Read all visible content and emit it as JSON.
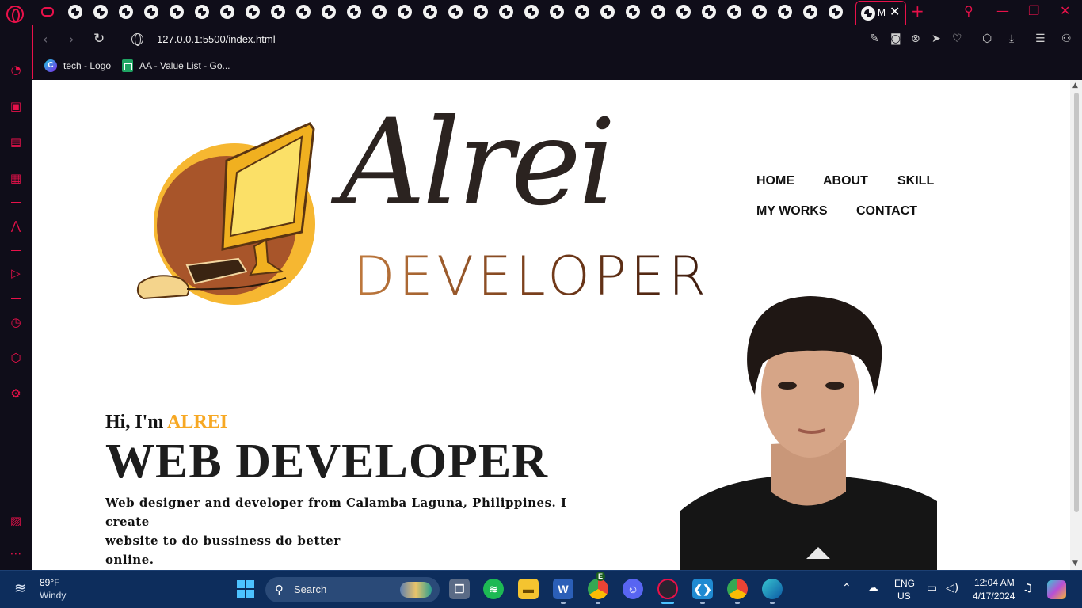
{
  "browser": {
    "active_tab_title": "M",
    "address": "127.0.0.1:5500/index.html",
    "accent_color": "#e8114a",
    "tab_favicon_count": 31,
    "bookmarks": [
      {
        "label": "tech - Logo",
        "icon": "canva-icon"
      },
      {
        "label": "AA - Value List - Go...",
        "icon": "sheets-icon"
      }
    ]
  },
  "site": {
    "brand_name": "Alrei",
    "brand_subtitle": "DEVELOPER",
    "nav": [
      "HOME",
      "ABOUT",
      "SKILL",
      "MY WORKS",
      "CONTACT"
    ],
    "greeting_prefix": "Hi, I'm ",
    "greeting_name": "ALREI",
    "role": "WEB DEVELOPER",
    "description_line1": "Web designer and developer from Calamba Laguna, Philippines. I create",
    "description_line2": "website to do bussiness do better",
    "description_line3": "online.",
    "accent_color": "#f7a823"
  },
  "taskbar": {
    "weather_temp": "89°F",
    "weather_condition": "Windy",
    "search_placeholder": "Search",
    "language_top": "ENG",
    "language_bottom": "US",
    "time": "12:04 AM",
    "date": "4/17/2024",
    "chrome_badge": "E"
  }
}
